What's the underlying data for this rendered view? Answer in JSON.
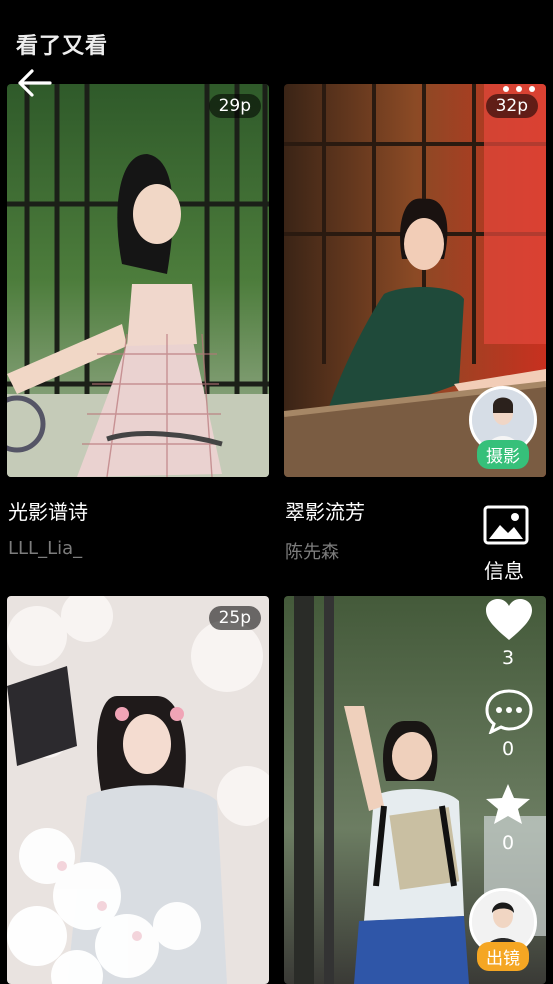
{
  "header": {
    "title": "看了又看"
  },
  "icons": {
    "back": "arrow-left-icon",
    "more": "more-dots-icon"
  },
  "cards": [
    {
      "count": "29p",
      "title": "光影谱诗",
      "author": "LLL_Lia_"
    },
    {
      "count": "32p",
      "title": "翠影流芳",
      "author": "陈先森"
    },
    {
      "count": "25p"
    },
    {}
  ],
  "rail": {
    "info_label": "信息",
    "likes": "3",
    "comments": "0",
    "favorites": "0",
    "photographer_tag": "摄影",
    "model_tag": "出镜",
    "colors": {
      "photographer_tag": "#36c07a",
      "model_tag": "#f5a623"
    }
  }
}
